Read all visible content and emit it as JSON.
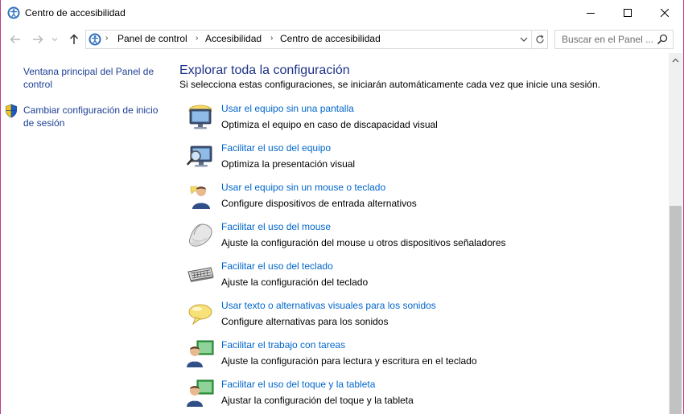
{
  "window": {
    "title": "Centro de accesibilidad"
  },
  "nav": {
    "back_icon": "arrow-left-icon",
    "forward_icon": "arrow-right-icon",
    "up_icon": "arrow-up-icon"
  },
  "address_bar": {
    "breadcrumbs": [
      "Panel de control",
      "Accesibilidad",
      "Centro de accesibilidad"
    ],
    "separator": "›"
  },
  "search": {
    "placeholder": "Buscar en el Panel ..."
  },
  "left_pane": {
    "links": [
      "Ventana principal del Panel de control",
      "Cambiar configuración de inicio de sesión"
    ]
  },
  "main": {
    "title": "Explorar toda la configuración",
    "subtitle": "Si selecciona estas configuraciones, se iniciarán automáticamente cada vez que inicie una sesión.",
    "items": [
      {
        "link": "Usar el equipo sin una pantalla",
        "desc": "Optimiza el equipo en caso de discapacidad visual",
        "icon": "monitor-icon"
      },
      {
        "link": "Facilitar el uso del equipo",
        "desc": "Optimiza la presentación visual",
        "icon": "magnifier-monitor-icon"
      },
      {
        "link": "Usar el equipo sin un mouse o teclado",
        "desc": "Configure dispositivos de entrada alternativos",
        "icon": "person-speech-icon"
      },
      {
        "link": "Facilitar el uso del mouse",
        "desc": "Ajuste la configuración del mouse u otros dispositivos señaladores",
        "icon": "mouse-icon"
      },
      {
        "link": "Facilitar el uso del teclado",
        "desc": "Ajuste la configuración del teclado",
        "icon": "keyboard-icon"
      },
      {
        "link": "Usar texto o alternativas visuales para los sonidos",
        "desc": "Configure alternativas para los sonidos",
        "icon": "speech-bubble-icon"
      },
      {
        "link": "Facilitar el trabajo con tareas",
        "desc": "Ajuste la configuración para lectura y escritura en el teclado",
        "icon": "person-board-icon"
      },
      {
        "link": "Facilitar el uso del toque y la tableta",
        "desc": "Ajustar la configuración del toque y la tableta",
        "icon": "person-tablet-icon"
      }
    ]
  },
  "colors": {
    "link": "#0066cc",
    "heading": "#1e3287",
    "left_link": "#1c3f94",
    "window_border": "#c03c8a"
  }
}
